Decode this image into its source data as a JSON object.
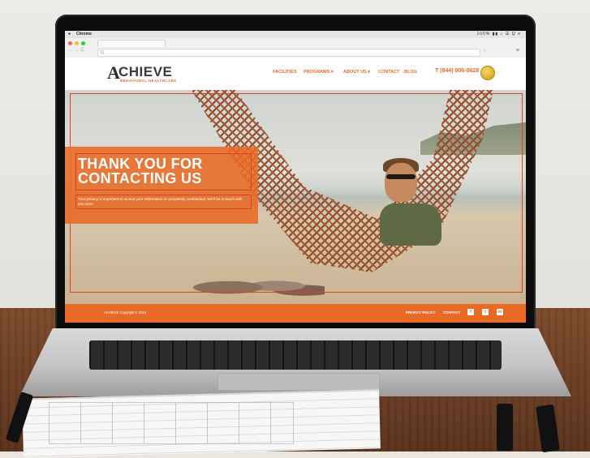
{
  "os_bar": {
    "app_name": "Chrome",
    "status": "100% ▮▮ ⌂ ☰ Q ≡"
  },
  "browser": {
    "back_forward": "← → C",
    "address_text": "Q"
  },
  "site": {
    "logo": {
      "word": "CHIEVE",
      "mark": "A",
      "tagline": "BEHAVIORAL HEALTHCARE"
    },
    "nav": [
      "FACILITIES",
      "PROGRAMS ▾",
      "ABOUT US ▾",
      "CONTACT",
      "BLOG"
    ],
    "phone": "T (844) 906-0628"
  },
  "hero": {
    "title": "THANK YOU FOR CONTACTING US",
    "body": "Your privacy is important to us and your information is completely confidential. We'll be in touch with you soon."
  },
  "footer": {
    "copyright": "ACHIEVE Copyright © 2016",
    "links": [
      "PRIVACY POLICY",
      "CONTACT"
    ],
    "social_icons": [
      "facebook-icon",
      "twitter-icon",
      "linkedin-icon"
    ],
    "social_glyphs": [
      "f",
      "t",
      "in"
    ]
  },
  "colors": {
    "accent": "#e86a24",
    "frame": "#e04020",
    "footer": "#e86a24"
  }
}
